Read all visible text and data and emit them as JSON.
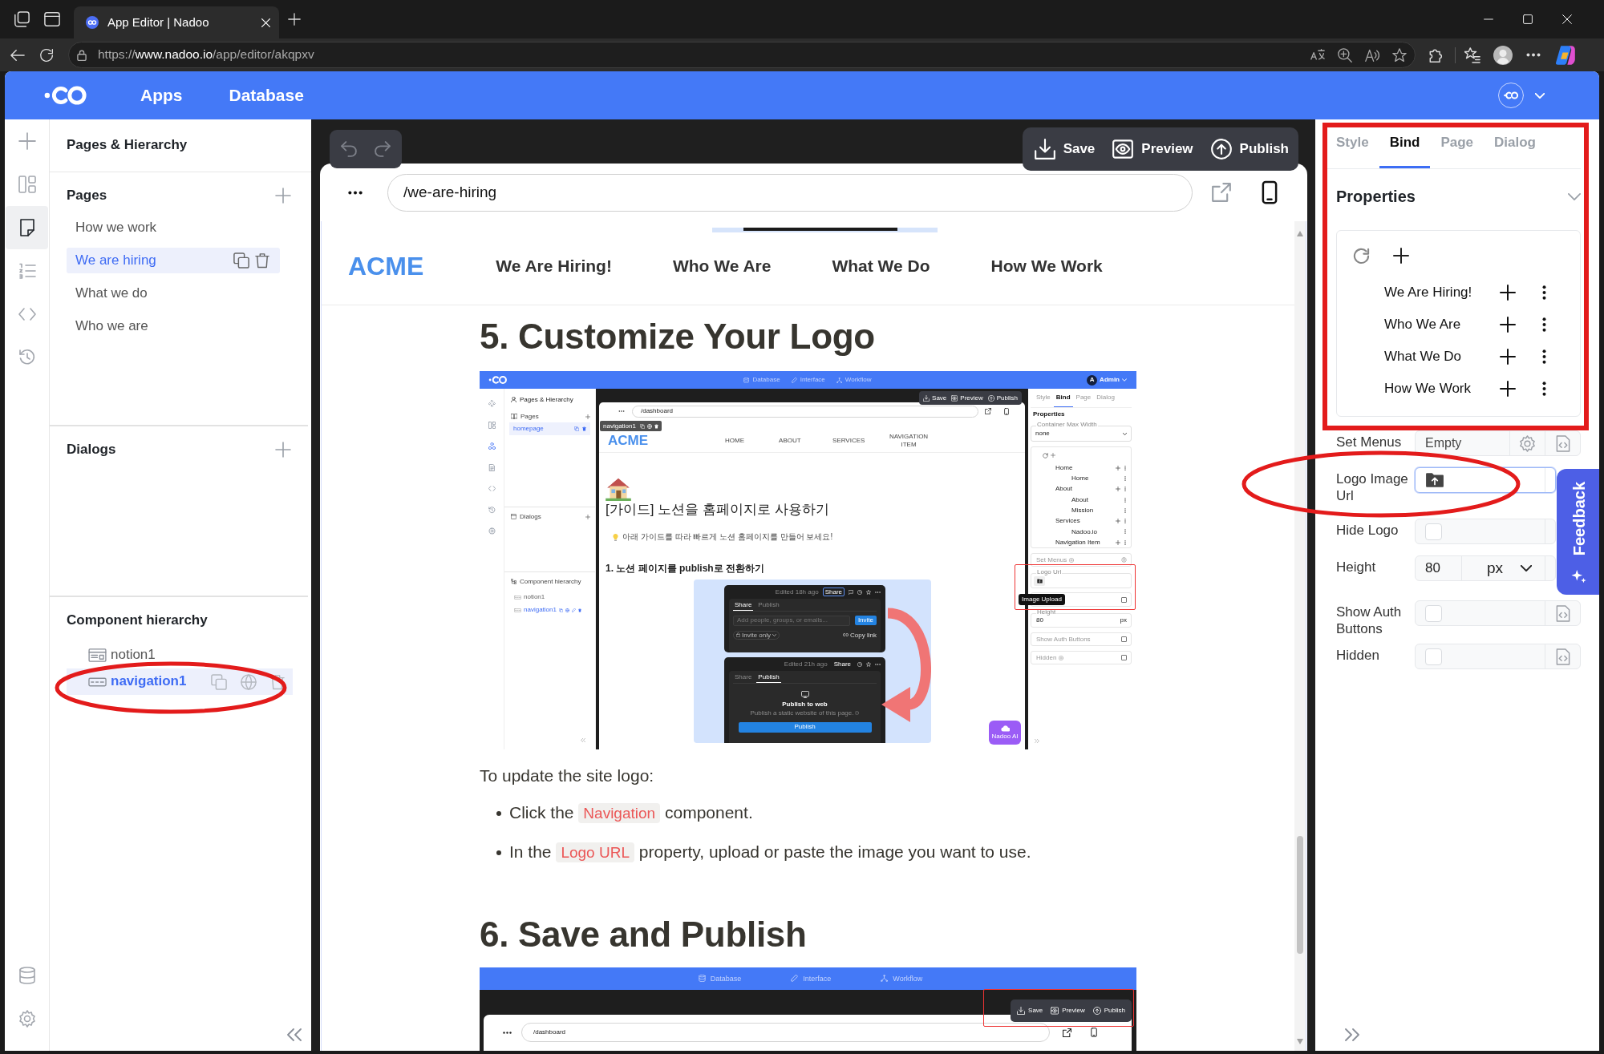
{
  "browser": {
    "tab_title": "App Editor | Nadoo",
    "url": {
      "scheme": "https://",
      "host": "www.nadoo.io",
      "path": "/app/editor/akqpxv"
    }
  },
  "app_header": {
    "nav": [
      "Apps",
      "Database"
    ]
  },
  "icon_rail": {
    "top": [
      {
        "selected": false
      },
      {
        "selected": false
      },
      {
        "selected": true
      },
      {
        "selected": false
      },
      {
        "selected": false
      },
      {
        "selected": false
      }
    ],
    "bottom": [
      {
        "selected": false
      },
      {
        "selected": false
      }
    ]
  },
  "left_panel": {
    "title": "Pages & Hierarchy",
    "pages": {
      "heading": "Pages",
      "items": [
        {
          "label": "How we work",
          "selected": false
        },
        {
          "label": "We are hiring",
          "selected": true
        },
        {
          "label": "What we do",
          "selected": false
        },
        {
          "label": "Who we are",
          "selected": false
        }
      ]
    },
    "dialogs": {
      "heading": "Dialogs"
    },
    "components": {
      "heading": "Component hierarchy",
      "items": [
        {
          "kind": "notion",
          "label": "notion1",
          "selected": false
        },
        {
          "kind": "navigation",
          "label": "navigation1",
          "selected": true
        }
      ]
    }
  },
  "editor": {
    "toolbar": [
      {
        "kind": "save",
        "label": "Save"
      },
      {
        "kind": "preview",
        "label": "Preview"
      },
      {
        "kind": "publish",
        "label": "Publish"
      }
    ],
    "path": "/we-are-hiring",
    "site_nav": {
      "logo": "ACME",
      "links": [
        "We Are Hiring!",
        "Who We Are",
        "What We Do",
        "How We Work"
      ]
    },
    "document": [
      {
        "kind": "heading",
        "text": "5. Customize Your Logo"
      },
      {
        "kind": "screenshot",
        "screen": {
          "header": {
            "nav": [
              "Database",
              "Interface",
              "Workflow"
            ],
            "avatar": "A",
            "user": "Admin"
          },
          "rail": [
            {
              "selected": false
            },
            {
              "selected": false
            },
            {
              "selected": true
            },
            {
              "selected": false
            },
            {
              "selected": false
            },
            {
              "selected": false
            },
            {
              "selected": false
            }
          ],
          "left_panel": {
            "title": "Pages & Hierarchy",
            "pages_heading": "Pages",
            "pages": [
              {
                "label": "homepage",
                "selected": true
              }
            ],
            "dialogs_heading": "Dialogs",
            "components_heading": "Component hierarchy",
            "components": [
              {
                "label": "notion1",
                "selected": false
              },
              {
                "label": "navigation1",
                "selected": true
              }
            ]
          },
          "toolbar": [
            {
              "kind": "save",
              "label": "Save"
            },
            {
              "kind": "preview",
              "label": "Preview"
            },
            {
              "kind": "publish",
              "label": "Publish"
            }
          ],
          "path": "/dashboard",
          "selection_tag": "navigation1",
          "site_nav": {
            "logo": "ACME",
            "links": [
              "HOME",
              "ABOUT",
              "SERVICES",
              "NAVIGATION ITEM"
            ]
          },
          "page": {
            "title": "[가이드] 노션을 홈페이지로 사용하기",
            "callout": "아래 가이드를 따라 빠르게 노션 홈페이지를 만들어 보세요!",
            "section": "1. 노션 페이지를 publish로 전환하기",
            "dialogs": [
              {
                "kind": "share",
                "edited": "Edited 18h ago",
                "share": "Share",
                "tabs": [
                  {
                    "label": "Share",
                    "selected": true
                  },
                  {
                    "label": "Publish",
                    "selected": false
                  }
                ],
                "placeholder": "Add people, groups, or emails...",
                "invite": "Invite",
                "access": "Invite only",
                "copy_link": "Copy link"
              },
              {
                "kind": "publish",
                "edited": "Edited 21h ago",
                "share": "Share",
                "tabs": [
                  {
                    "label": "Share",
                    "selected": false
                  },
                  {
                    "label": "Publish",
                    "selected": true
                  }
                ],
                "title": "Publish to web",
                "text": "Publish a static website of this page.",
                "button": "Publish"
              }
            ]
          },
          "properties_panel": {
            "tabs": [
              {
                "label": "Style",
                "selected": false
              },
              {
                "label": "Bind",
                "selected": true
              },
              {
                "label": "Page",
                "selected": false
              },
              {
                "label": "Dialog",
                "selected": false
              }
            ],
            "heading": "Properties",
            "container_width": {
              "label": "Container Max Width",
              "value": "none"
            },
            "menu_tree": [
              {
                "label": "Home",
                "children": [
                  {
                    "label": "Home"
                  }
                ]
              },
              {
                "label": "About",
                "children": [
                  {
                    "label": "About"
                  },
                  {
                    "label": "Mission"
                  }
                ]
              },
              {
                "label": "Services",
                "children": [
                  {
                    "label": "Nadoo.io"
                  }
                ]
              },
              {
                "label": "Navigation Item"
              }
            ],
            "fields": [
              {
                "kind": "menus",
                "label": "Set Menus"
              },
              {
                "kind": "upload",
                "label": "Logo Url",
                "tooltip": "Image Upload"
              },
              {
                "kind": "checkbox",
                "checked": false
              },
              {
                "kind": "size",
                "label": "Height",
                "value": "80",
                "unit": "px"
              },
              {
                "kind": "checkbox",
                "label": "Show Auth Buttons",
                "checked": false
              },
              {
                "kind": "bindable_checkbox",
                "label": "Hidden",
                "checked": false
              }
            ]
          },
          "ai_button": "Nadoo AI"
        }
      },
      {
        "kind": "paragraph",
        "text": "To update the site logo:"
      },
      {
        "kind": "bullet",
        "text": "Click the",
        "code": "Navigation",
        "after": "component."
      },
      {
        "kind": "bullet",
        "text": "In the",
        "code": "Logo URL",
        "after": "property, upload or paste the image you want to use."
      },
      {
        "kind": "heading",
        "text": "6. Save and Publish"
      },
      {
        "kind": "screenshot_crop",
        "screen": {
          "nav": [
            "Database",
            "Interface",
            "Workflow"
          ],
          "toolbar": [
            {
              "kind": "save",
              "label": "Save"
            },
            {
              "kind": "preview",
              "label": "Preview"
            },
            {
              "kind": "publish",
              "label": "Publish"
            }
          ],
          "path": "/dashboard"
        }
      }
    ]
  },
  "properties_panel": {
    "tabs": [
      {
        "label": "Style",
        "selected": false
      },
      {
        "label": "Bind",
        "selected": true
      },
      {
        "label": "Page",
        "selected": false
      },
      {
        "label": "Dialog",
        "selected": false
      }
    ],
    "heading": "Properties",
    "menu_items": [
      {
        "label": "We Are Hiring!"
      },
      {
        "label": "Who We Are"
      },
      {
        "label": "What We Do"
      },
      {
        "label": "How We Work"
      }
    ],
    "fields": [
      {
        "kind": "text",
        "label": "Set Menus",
        "value": "Empty"
      },
      {
        "kind": "upload",
        "label": "Logo Image Url",
        "focused": true
      },
      {
        "kind": "checkbox",
        "label": "Hide Logo",
        "checked": false
      },
      {
        "kind": "size",
        "label": "Height",
        "value": "80",
        "unit": "px"
      },
      {
        "kind": "checkbox",
        "label": "Show Auth Buttons",
        "checked": false
      },
      {
        "kind": "checkbox",
        "label": "Hidden",
        "checked": false
      }
    ]
  },
  "feedback_tab": {
    "label": "Feedback"
  }
}
